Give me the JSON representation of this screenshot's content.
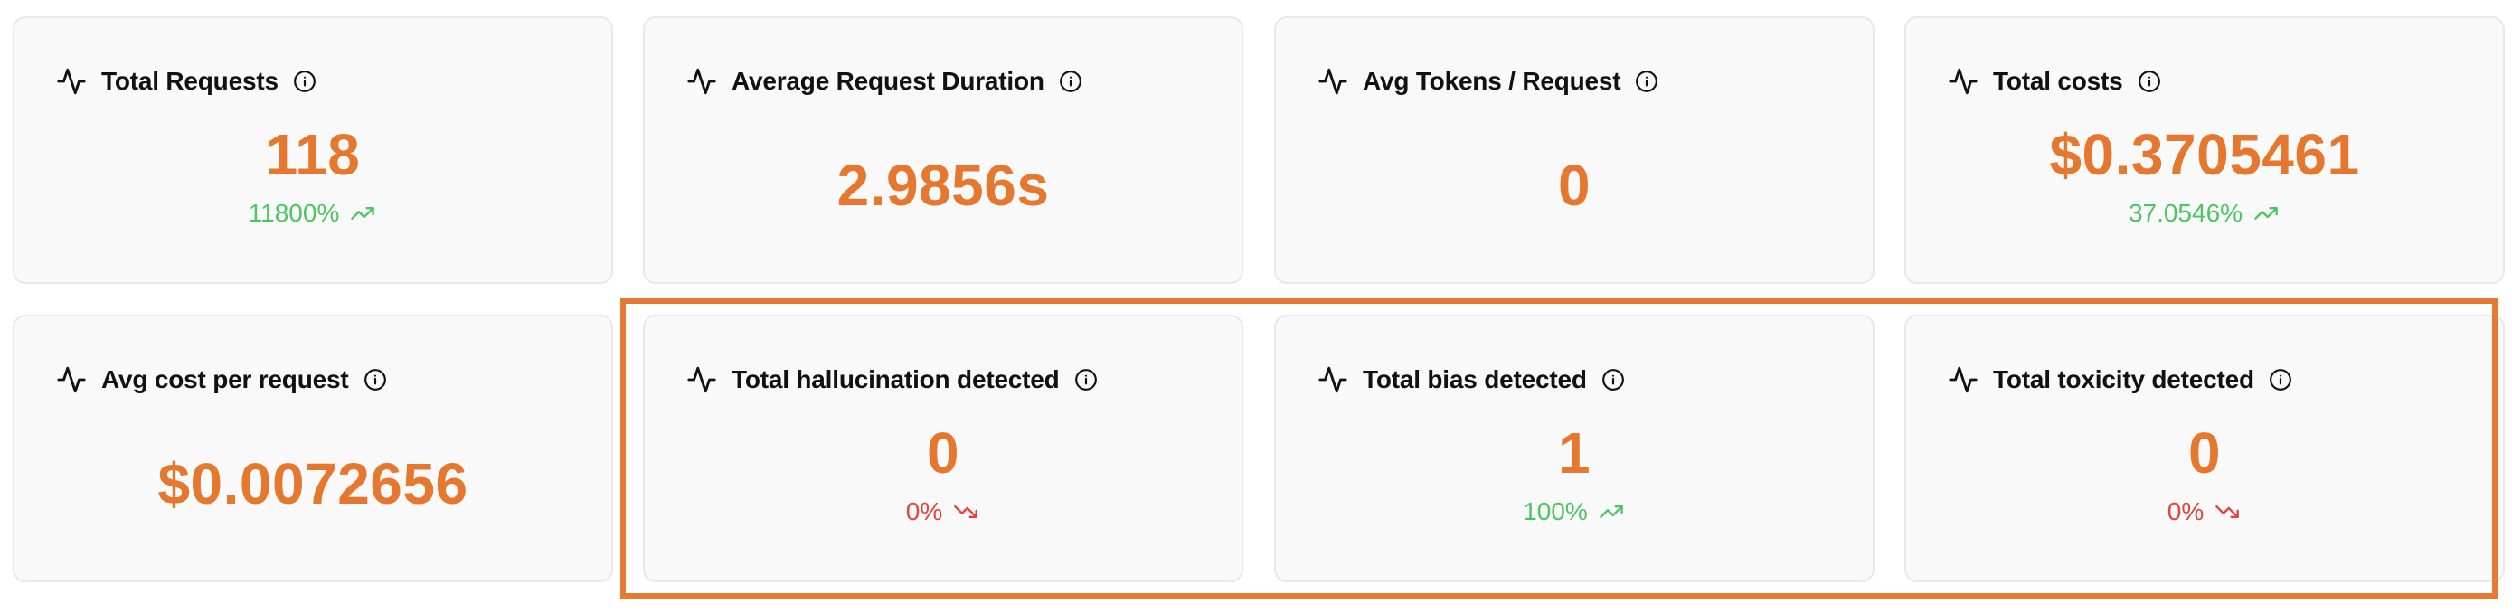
{
  "accent_color": "#e5772e",
  "up_color": "#4fc462",
  "down_color": "#e0443a",
  "highlight_color": "#e57a33",
  "icons": {
    "card_icon": "activity-pulse-icon",
    "info_icon": "info-circle-icon",
    "trend_up_icon": "trending-up-icon",
    "trend_down_icon": "trending-down-icon"
  },
  "cards": [
    {
      "title": "Total Requests",
      "value": "118",
      "trend": "11800%",
      "trend_dir": "up"
    },
    {
      "title": "Average Request Duration",
      "value": "2.9856s",
      "trend": null
    },
    {
      "title": "Avg Tokens / Request",
      "value": "0",
      "trend": null
    },
    {
      "title": "Total costs",
      "value": "$0.3705461",
      "trend": "37.0546%",
      "trend_dir": "up"
    },
    {
      "title": "Avg cost per request",
      "value": "$0.0072656",
      "trend": null
    },
    {
      "title": "Total hallucination detected",
      "value": "0",
      "trend": "0%",
      "trend_dir": "down"
    },
    {
      "title": "Total bias detected",
      "value": "1",
      "trend": "100%",
      "trend_dir": "up"
    },
    {
      "title": "Total toxicity detected",
      "value": "0",
      "trend": "0%",
      "trend_dir": "down"
    }
  ]
}
